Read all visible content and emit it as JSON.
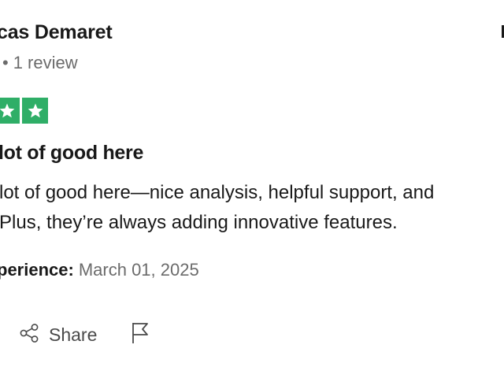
{
  "review": {
    "reviewer_name": "cas Demaret",
    "reviewer_meta_separator": "•",
    "reviewer_review_count": "1 review",
    "rating_stars": 2,
    "star_color": "#2fae67",
    "title": "lot of good here",
    "body_lines": [
      "lot of good here—nice analysis, helpful support, and",
      "Plus, they’re always adding innovative features."
    ],
    "experience_label": "perience:",
    "experience_date": "March 01, 2025"
  },
  "actions": {
    "share_label": "Share",
    "share_icon": "share-icon",
    "flag_icon": "flag-icon"
  }
}
